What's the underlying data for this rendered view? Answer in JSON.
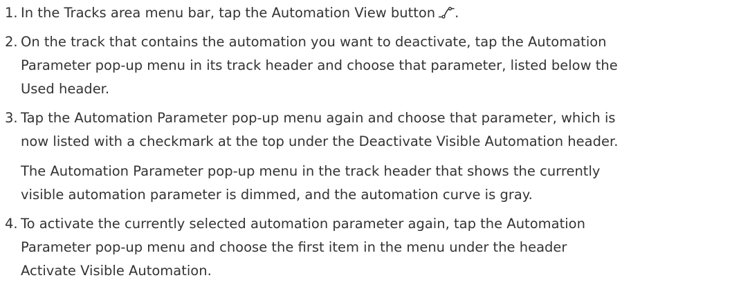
{
  "steps": [
    {
      "number": "1.",
      "paragraphs": [
        {
          "lines": [
            "In the Tracks area menu bar, tap the Automation View button"
          ],
          "suffix": "."
        }
      ],
      "icon": "automation-curve-icon"
    },
    {
      "number": "2.",
      "paragraphs": [
        {
          "lines": [
            "On the track that contains the automation you want to deactivate, tap the Automation",
            "Parameter pop-up menu in its track header and choose that parameter, listed below the",
            "Used header."
          ]
        }
      ]
    },
    {
      "number": "3.",
      "paragraphs": [
        {
          "lines": [
            "Tap the Automation Parameter pop-up menu again and choose that parameter, which is",
            "now listed with a checkmark at the top under the Deactivate Visible Automation header."
          ]
        },
        {
          "lines": [
            "The Automation Parameter pop-up menu in the track header that shows the currently",
            "visible automation parameter is dimmed, and the automation curve is gray."
          ]
        }
      ]
    },
    {
      "number": "4.",
      "paragraphs": [
        {
          "lines": [
            "To activate the currently selected automation parameter again, tap the Automation",
            "Parameter pop-up menu and choose the first item in the menu under the header",
            "Activate Visible Automation."
          ]
        }
      ]
    }
  ]
}
